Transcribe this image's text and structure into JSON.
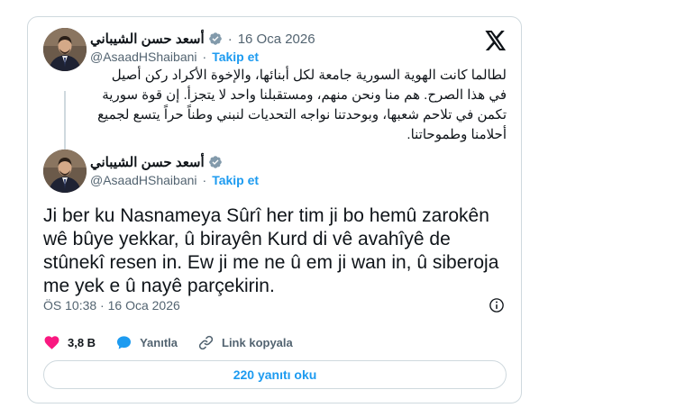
{
  "quoted": {
    "name": "أسعد حسن الشيباني",
    "date": "16 Oca 2026",
    "handle": "@AsaadHShaibani",
    "follow_label": "Takip et",
    "text": "لطالما كانت الهوية السورية جامعة لكل أبنائها، والإخوة الأكراد ركن أصيل في هذا الصرح. هم منا ونحن منهم، ومستقبلنا واحد لا يتجزأ. إن قوة سورية تكمن في تلاحم شعبها، وبوحدتنا نواجه التحديات لنبني وطناً حراً يتسع لجميع أحلامنا وطموحاتنا."
  },
  "main": {
    "name": "أسعد حسن الشيباني",
    "handle": "@AsaadHShaibani",
    "follow_label": "Takip et",
    "text": "Ji ber ku Nasnameya Sûrî her tim ji bo hemû zarokên wê bûye yekkar, û birayên Kurd di vê avahîyê de stûnekî resen in. Ew ji me ne û em ji wan in, û siberoja me yek e û nayê parçekirin.",
    "time": "ÖS 10:38",
    "date": "16 Oca 2026"
  },
  "actions": {
    "likes": "3,8 B",
    "reply_label": "Yanıtla",
    "copy_link_label": "Link kopyala"
  },
  "read_replies_label": "220 yanıtı oku",
  "icons": {
    "logo": "x-logo-icon",
    "verified": "verified-badge-icon",
    "info": "info-icon",
    "like": "heart-icon",
    "reply": "speech-bubble-icon",
    "link": "link-icon"
  },
  "colors": {
    "accent": "#1d9bf0",
    "like": "#f91880",
    "text": "#0f1419",
    "muted": "#536471",
    "border": "#cfd9de"
  }
}
